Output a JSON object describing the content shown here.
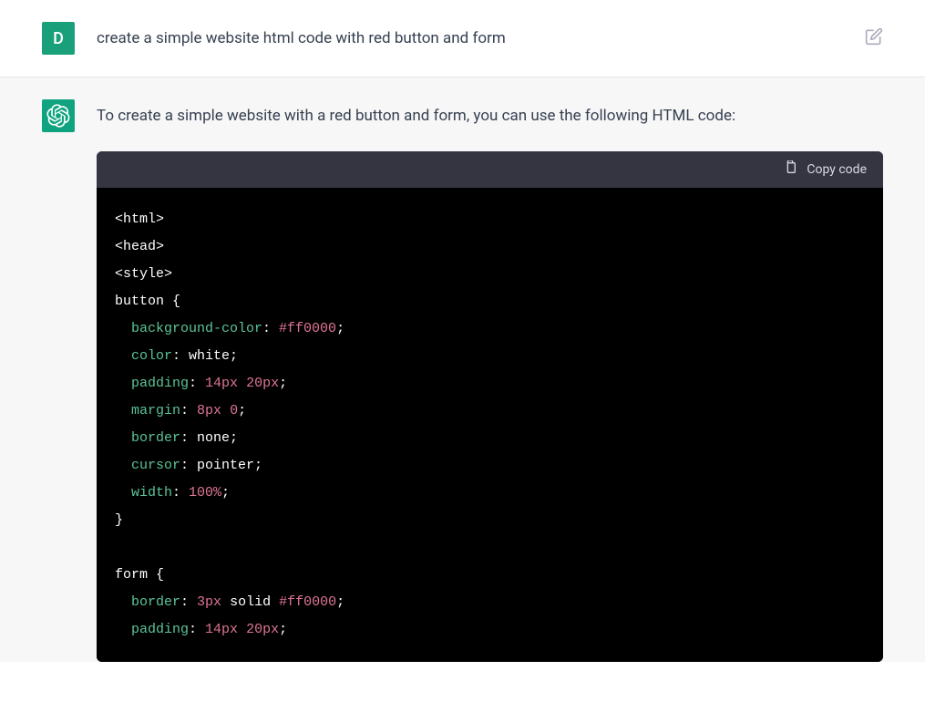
{
  "user": {
    "avatar_letter": "D",
    "message": "create a simple website html code with red button and form"
  },
  "assistant": {
    "intro": "To create a simple website with a red button and form, you can use the following HTML code:",
    "copy_label": "Copy code",
    "code": {
      "l1": "<html>",
      "l2": "<head>",
      "l3": "<style>",
      "l4_sel": "button",
      "l4_brace": " {",
      "l5_prop": "background-color",
      "l5_val": "#ff0000",
      "l6_prop": "color",
      "l6_val": "white",
      "l7_prop": "padding",
      "l7_v1": "14px",
      "l7_v2": "20px",
      "l8_prop": "margin",
      "l8_v1": "8px",
      "l8_v2": "0",
      "l9_prop": "border",
      "l9_val": "none",
      "l10_prop": "cursor",
      "l10_val": "pointer",
      "l11_prop": "width",
      "l11_val": "100%",
      "l12": "}",
      "l14_sel": "form",
      "l14_brace": " {",
      "l15_prop": "border",
      "l15_v1": "3px",
      "l15_v2": "solid",
      "l15_v3": "#ff0000",
      "l16_prop": "padding",
      "l16_v1": "14px",
      "l16_v2": "20px"
    }
  }
}
